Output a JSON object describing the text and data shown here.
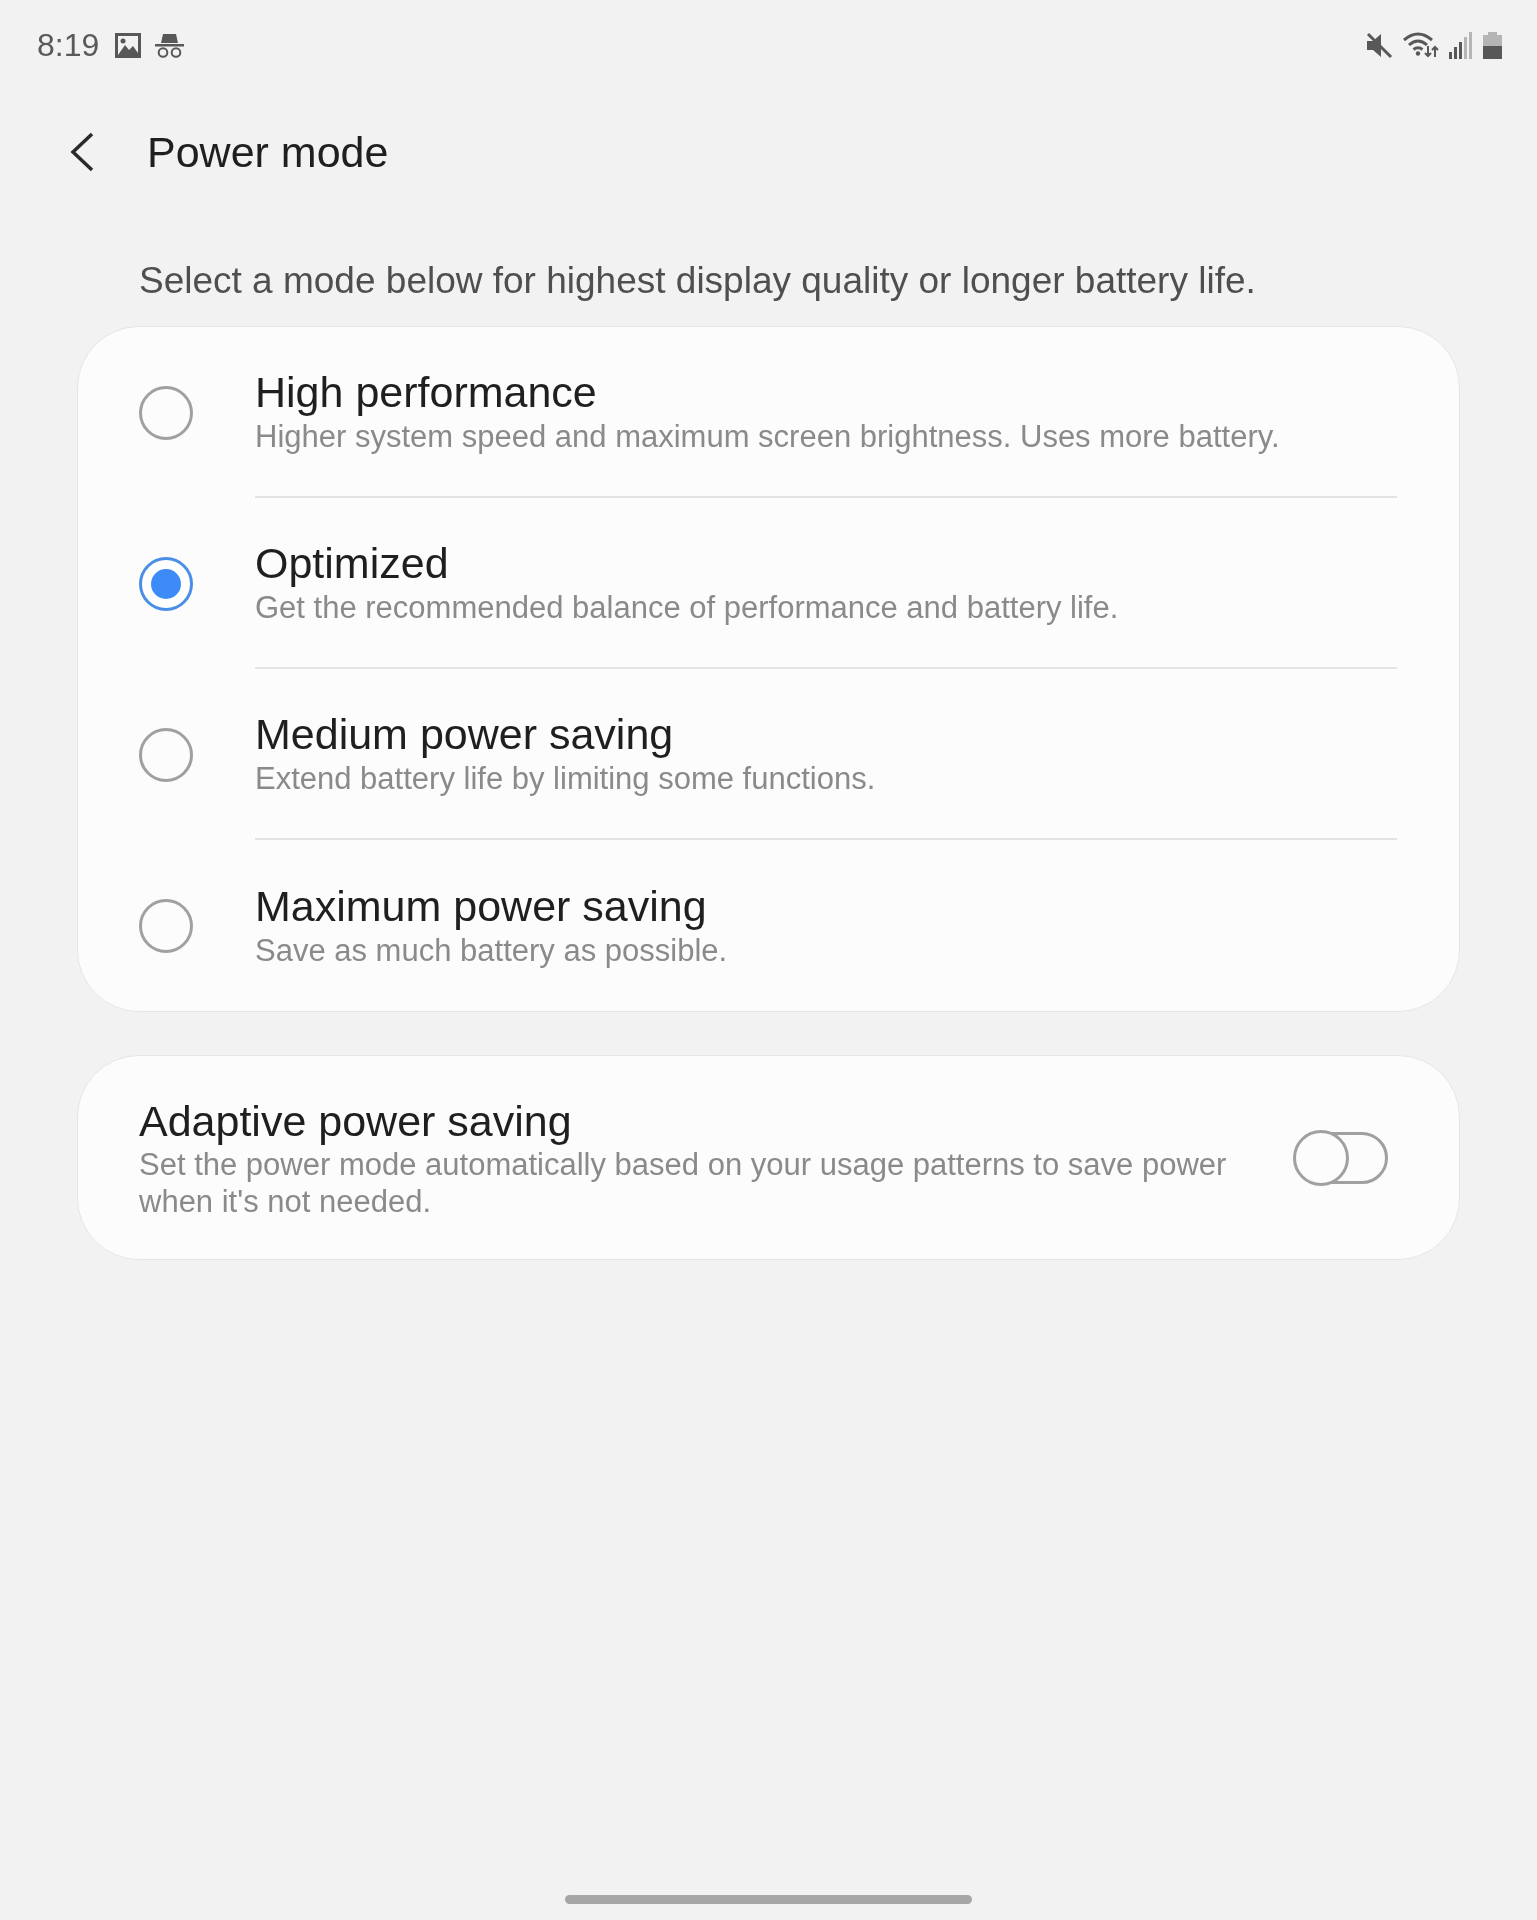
{
  "status_bar": {
    "time": "8:19"
  },
  "header": {
    "title": "Power mode"
  },
  "description": "Select a mode below for highest display quality or longer battery life.",
  "modes": [
    {
      "title": "High performance",
      "subtitle": "Higher system speed and maximum screen brightness. Uses more battery.",
      "selected": false
    },
    {
      "title": "Optimized",
      "subtitle": "Get the recommended balance of performance and battery life.",
      "selected": true
    },
    {
      "title": "Medium power saving",
      "subtitle": "Extend battery life by limiting some functions.",
      "selected": false
    },
    {
      "title": "Maximum power saving",
      "subtitle": "Save as much battery as possible.",
      "selected": false
    }
  ],
  "adaptive_power_saving": {
    "title": "Adaptive power saving",
    "subtitle": "Set the power mode automatically based on your usage patterns to save power when it's not needed.",
    "on": false
  }
}
